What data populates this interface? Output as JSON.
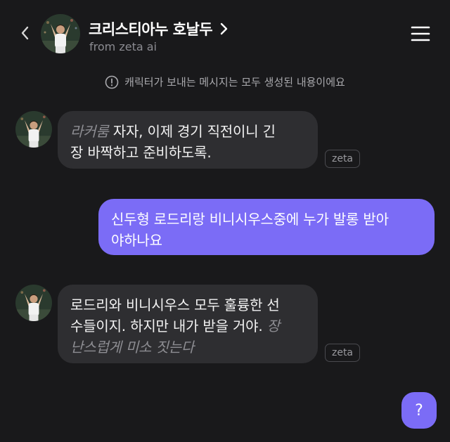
{
  "header": {
    "title": "크리스티아누 호날두",
    "subtitle": "from zeta ai"
  },
  "notice": {
    "text": "캐릭터가 보내는 메시지는 모두 생성된 내용이에요"
  },
  "messages": [
    {
      "sender": "bot",
      "action": "라커룸",
      "line1": "자자, 이제 경기 직전이니 긴",
      "line2": "장 바짝하고 준비하도록.",
      "tag": "zeta"
    },
    {
      "sender": "user",
      "line1": "신두형 로드리랑 비니시우스중에 누가 발롱 받아",
      "line2": "야하나요"
    },
    {
      "sender": "bot",
      "line1": "로드리와 비니시우스 모두 훌륭한 선",
      "line2_text": "수들이지. 하지만 내가 받을 거야.",
      "line2_action": "장",
      "line3_action": "난스럽게 미소 짓는다",
      "tag": "zeta"
    }
  ],
  "help_button": {
    "label": "?"
  },
  "colors": {
    "background": "#19191b",
    "bot_bubble": "#2e2e31",
    "user_bubble": "#7b6cf6",
    "accent": "#7b6cf6",
    "muted_text": "#8e8e93"
  },
  "icons": {
    "back": "chevron-left-icon",
    "title_chevron": "chevron-right-icon",
    "menu": "hamburger-menu-icon",
    "notice": "exclamation-circle-icon"
  }
}
